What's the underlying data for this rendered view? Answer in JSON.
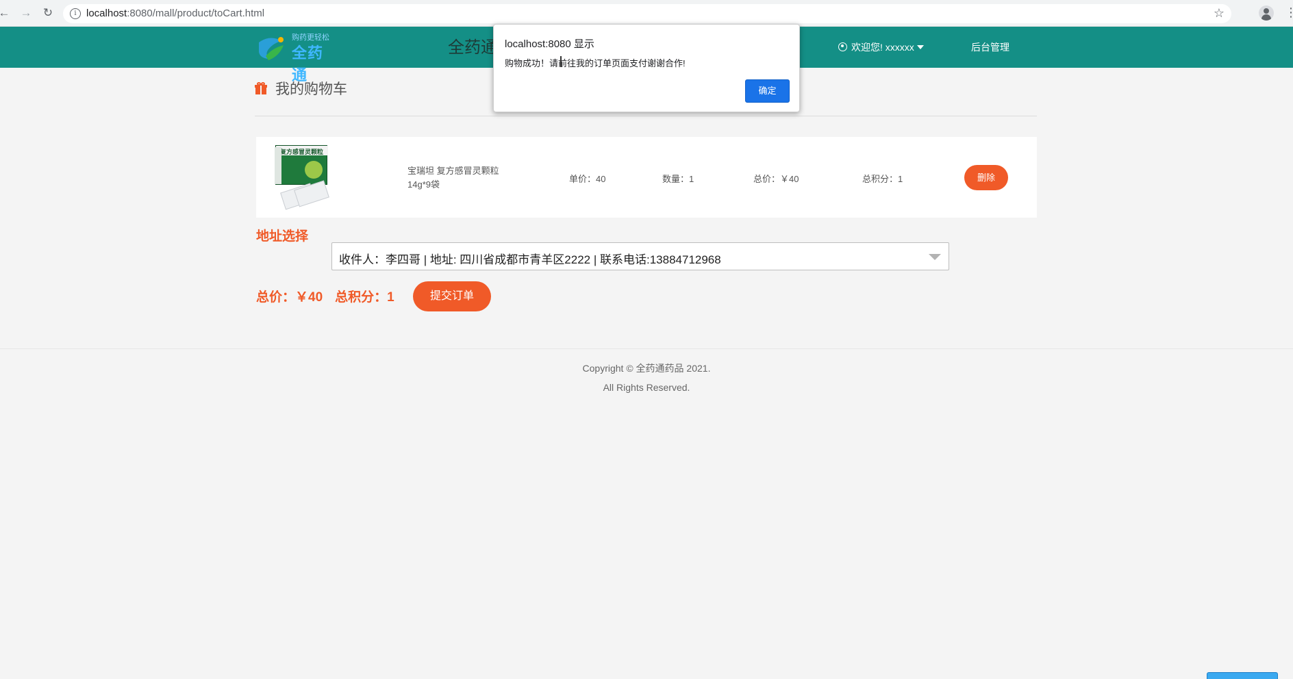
{
  "browser": {
    "url_host": "localhost",
    "url_rest": ":8080/mall/product/toCart.html"
  },
  "header": {
    "logo_tagline": "购药更轻松",
    "logo_name": "全药通",
    "site_title": "全药通",
    "user_greeting": "欢迎您! xxxxxx",
    "admin_link": "后台管理"
  },
  "cart": {
    "title": "我的购物车",
    "items": [
      {
        "package_label": "复方感冒灵颗粒",
        "name": "宝瑞坦 复方感冒灵颗粒 14g*9袋",
        "unit_price": "单价：40",
        "quantity": "数量：1",
        "total": "总价：￥40",
        "points": "总积分：1",
        "delete_label": "删除"
      }
    ]
  },
  "address": {
    "label": "地址选择",
    "selected": "收件人：李四哥 | 地址: 四川省成都市青羊区2222 | 联系电话:13884712968"
  },
  "summary": {
    "total": "总价：￥40",
    "points": "总积分：1",
    "submit_label": "提交订单"
  },
  "footer": {
    "copyright": "Copyright © 全药通药品 2021.",
    "rights": "All Rights Reserved."
  },
  "alert": {
    "title": "localhost:8080 显示",
    "message": "购物成功！请前往我的订单页面支付谢谢合作!",
    "ok_label": "确定"
  },
  "colors": {
    "header_bg": "#148f86",
    "accent": "#f05a28",
    "dialog_button": "#1a73e8"
  }
}
